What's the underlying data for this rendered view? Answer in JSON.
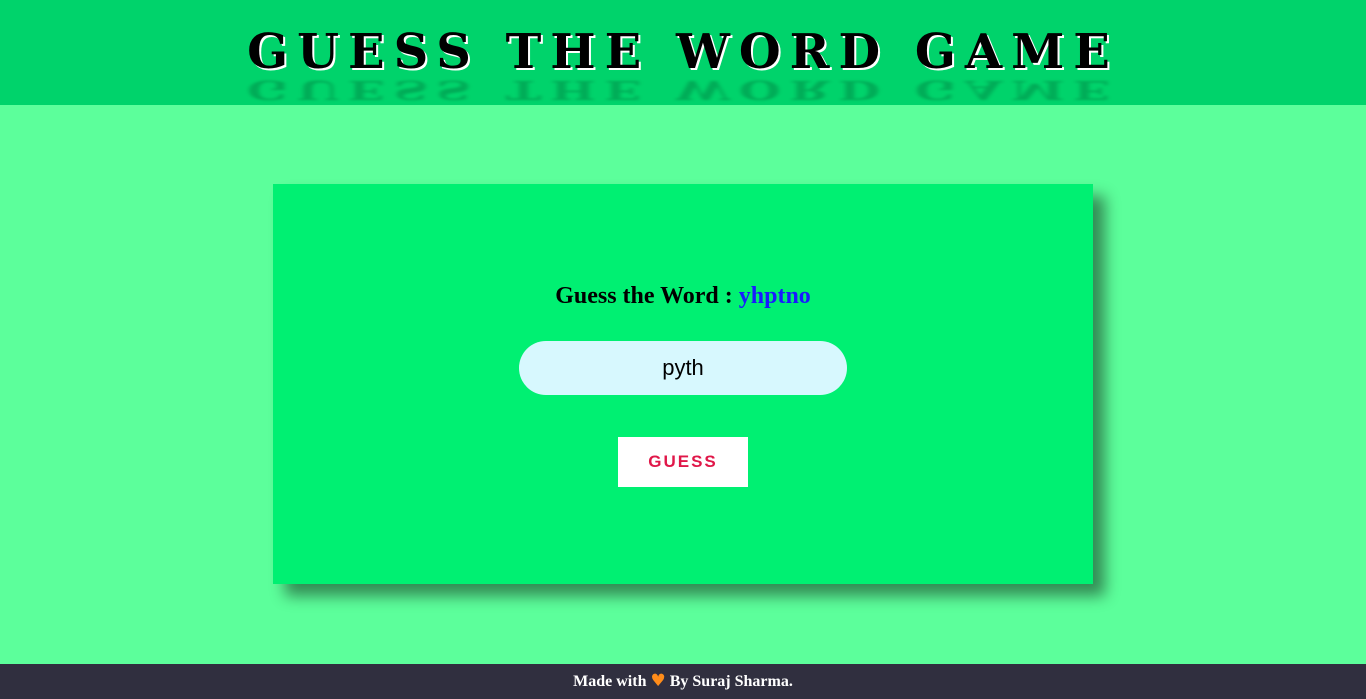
{
  "header": {
    "title": "GUESS THE WORD GAME"
  },
  "game": {
    "prompt_label": "Guess the Word :",
    "scrambled_word": "yhptno",
    "input_value": "pyth",
    "guess_button_label": "GUESS"
  },
  "footer": {
    "made_with": "Made with",
    "heart_icon": "heart-icon",
    "heart_glyph": "♥",
    "author": "By Suraj Sharma."
  },
  "colors": {
    "background": "#5cff9b",
    "header": "#00d36b",
    "card": "#00f072",
    "scrambled_word": "#1a1aff",
    "button_text": "#e01749",
    "input_bg": "#d7f8fe",
    "footer": "#302f3f",
    "heart": "#ff8c1a"
  }
}
